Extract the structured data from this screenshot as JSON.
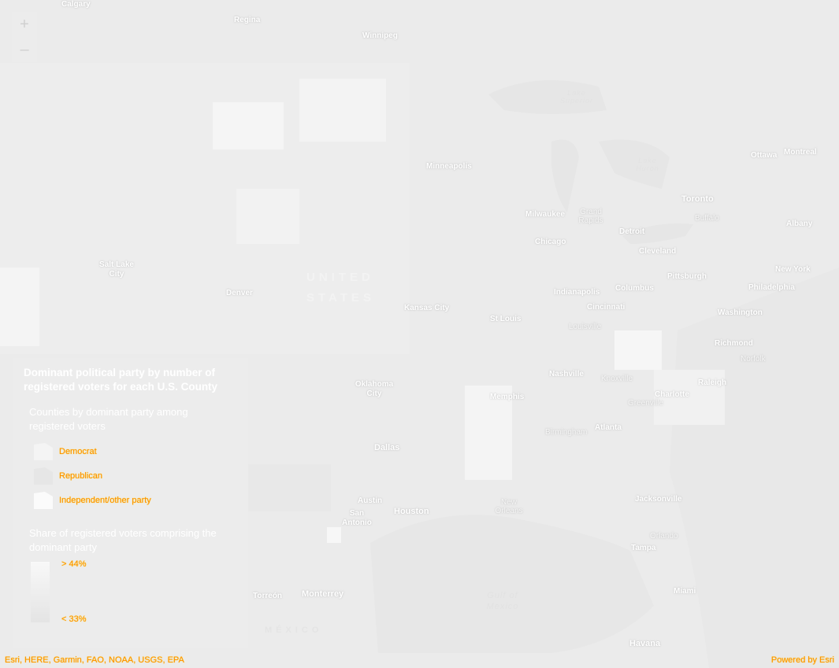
{
  "zoom": {
    "in_symbol": "+",
    "out_symbol": "–"
  },
  "places": {
    "calgary": "Calgary",
    "regina": "Regina",
    "winnipeg": "Winnipeg",
    "minneapolis": "Minneapolis",
    "ottawa": "Ottawa",
    "montreal": "Montreal",
    "toronto": "Toronto",
    "buffalo": "Buffalo",
    "albany": "Albany",
    "milwaukee": "Milwaukee",
    "grand_rapids": "Grand Rapids",
    "detroit": "Detroit",
    "chicago": "Chicago",
    "cleveland": "Cleveland",
    "new_york": "New York",
    "pittsburgh": "Pittsburgh",
    "philadelphia": "Philadelphia",
    "salt_lake_city": "Salt Lake City",
    "denver": "Denver",
    "kansas_city": "Kansas City",
    "indianapolis": "Indianapolis",
    "columbus": "Columbus",
    "cincinnati": "Cincinnati",
    "washington": "Washington",
    "st_louis": "St Louis",
    "louisville": "Louisville",
    "richmond": "Richmond",
    "norfolk": "Norfolk",
    "nashville": "Nashville",
    "knoxville": "Knoxville",
    "raleigh": "Raleigh",
    "oklahoma_city": "Oklahoma City",
    "memphis": "Memphis",
    "charlotte": "Charlotte",
    "greenville": "Greenville",
    "atlanta": "Atlanta",
    "birmingham": "Birmingham",
    "dallas": "Dallas",
    "austin": "Austin",
    "houston": "Houston",
    "san_antonio": "San Antonio",
    "new_orleans": "New Orleans",
    "jacksonville": "Jacksonville",
    "orlando": "Orlando",
    "tampa": "Tampa",
    "miami": "Miami",
    "torreon": "Torreón",
    "monterrey": "Monterrey",
    "havana": "Havana"
  },
  "country": {
    "us_line1": "UNITED",
    "us_line2": "STATES",
    "mexico": "MÉXICO"
  },
  "water": {
    "gulf": "Gulf of Mexico",
    "lake_superior": "Lake Superior",
    "lake_huron": "Lake Huron"
  },
  "legend": {
    "title": "Dominant political party by number of registered voters for each U.S. County",
    "subtitle_party": "Counties by dominant party among registered voters",
    "items": [
      {
        "label": "Democrat",
        "color": "#f4f4f4"
      },
      {
        "label": "Republican",
        "color": "#e6e6e6"
      },
      {
        "label": "Independent/other party",
        "color": "#fbfbfb"
      }
    ],
    "subtitle_share": "Share of registered voters comprising the dominant party",
    "ramp_high": "> 44%",
    "ramp_low": "< 33%"
  },
  "attribution": {
    "sources": "Esri, HERE, Garmin, FAO, NOAA, USGS, EPA",
    "powered": "Powered by Esri"
  },
  "colors": {
    "basemap": "#ebebeb",
    "county_light": "#f3f3f3",
    "county_dark": "#e4e4e4",
    "label_highlight": "#ff8c00"
  }
}
